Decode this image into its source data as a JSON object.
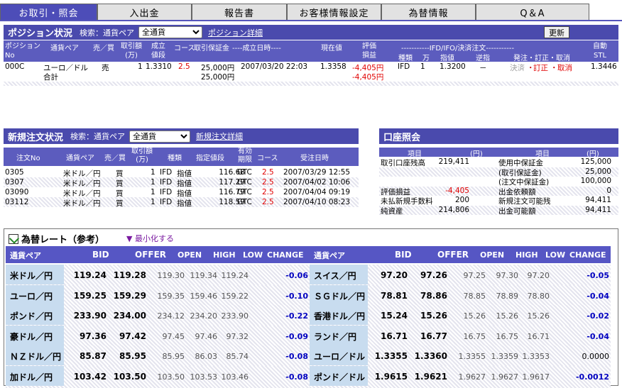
{
  "tabs": [
    {
      "label": "お取引・照会",
      "active": true
    },
    {
      "label": "入出金"
    },
    {
      "label": "報告書"
    },
    {
      "label": "お客様情報設定"
    },
    {
      "label": "為替情報"
    },
    {
      "label": "Q＆A"
    }
  ],
  "position": {
    "title": "ポジション状況",
    "search_label": "検索：通貨ペア",
    "select_value": "全通貨",
    "detail_link": "ポジション詳細",
    "refresh_label": "更新",
    "col_labels": {
      "no": "ポジション\nNo",
      "pair": "通貨ペア",
      "side": "売／買",
      "amount": "取引額\n(万)",
      "rate": "成立\n値段",
      "course": "コース",
      "margin": "取引保証金",
      "datetime": "----成立日時----",
      "current": "現在値",
      "pl": "評価\n損益",
      "ifo": "-----------IFD/IFO/決済注文-----------",
      "type": "種類",
      "man": "万",
      "limit": "指値",
      "stop": "逆指",
      "action": "発注・訂正・取消",
      "auto": "自動\nSTL"
    },
    "rows": [
      {
        "no": "000C",
        "pair": "ユーロ／ドル",
        "side": "売",
        "amount": "1",
        "rate": "1.3310",
        "course": "2.5",
        "margin": "25,000円",
        "datetime": "2007/03/20 22:03",
        "current": "1.3358",
        "pl": "-4,405円",
        "type": "IFD",
        "man": "1",
        "limit": "1.3200",
        "stop": "－",
        "act_settle": "決済",
        "act_edit": "訂正",
        "act_cancel": "取消",
        "auto": "1.3446"
      }
    ],
    "total_label": "合計",
    "total_margin": "25,000円",
    "total_pl": "-4,405円"
  },
  "orders": {
    "title": "新規注文状況",
    "search_label": "検索：通貨ペア",
    "select_value": "全通貨",
    "detail_link": "新規注文詳細",
    "col_labels": {
      "no": "注文No",
      "pair": "通貨ペア",
      "side": "売／買",
      "amount": "取引額\n(万)",
      "type": "種類",
      "spec": "指定値段",
      "expiry": "有効\n期限",
      "course": "コース",
      "datetime": "受注日時"
    },
    "rows": [
      {
        "no": "0305",
        "pair": "米ドル／円",
        "side": "買",
        "amount": "1",
        "type": "IFD",
        "kind": "指値",
        "price": "116.68",
        "expiry": "GTC",
        "course": "2.5",
        "datetime": "2007/03/29 12:55"
      },
      {
        "no": "0307",
        "pair": "米ドル／円",
        "side": "買",
        "amount": "1",
        "type": "IFD",
        "kind": "指値",
        "price": "117.29",
        "expiry": "GTC",
        "course": "2.5",
        "datetime": "2007/04/02 10:06"
      },
      {
        "no": "03090",
        "pair": "米ドル／円",
        "side": "買",
        "amount": "1",
        "type": "IFD",
        "kind": "指値",
        "price": "116.79",
        "expiry": "GTC",
        "course": "2.5",
        "datetime": "2007/04/04 09:19"
      },
      {
        "no": "03112",
        "pair": "米ドル／円",
        "side": "買",
        "amount": "1",
        "type": "IFD",
        "kind": "指値",
        "price": "118.59",
        "expiry": "GTC",
        "course": "2.5",
        "datetime": "2007/04/10 08:23"
      }
    ]
  },
  "account": {
    "title": "口座照会",
    "col_labels": {
      "item": "項目",
      "yen": "(円)",
      "item2": "項目",
      "yen2": "(円)"
    },
    "rows": [
      {
        "l": "取引口座残高",
        "lv": "219,411",
        "r": "使用中保証金",
        "rv": "125,000"
      },
      {
        "l": "",
        "lv": "",
        "r": "(取引保証金)",
        "rv": "25,000"
      },
      {
        "l": "",
        "lv": "",
        "r": "(注文中保証金)",
        "rv": "100,000"
      },
      {
        "l": "評価損益",
        "lv": "-4,405",
        "r": "出金依頼額",
        "rv": "0"
      },
      {
        "l": "未払新規手数料",
        "lv": "200",
        "r": "新規注文可能残",
        "rv": "94,411"
      },
      {
        "l": "純資産",
        "lv": "214,806",
        "r": "出金可能額",
        "rv": "94,411"
      }
    ]
  },
  "rates": {
    "title": "為替レート（参考）",
    "minimize": "▼ 最小化する",
    "headers": {
      "pair": "通貨ペア",
      "bid": "BID",
      "offer": "OFFER",
      "open": "OPEN",
      "high": "HIGH",
      "low": "LOW",
      "change": "CHANGE"
    },
    "left": [
      {
        "pair": "米ドル／円",
        "bid": "119.24",
        "offer": "119.28",
        "open": "119.30",
        "high": "119.34",
        "low": "119.24",
        "change": "-0.06"
      },
      {
        "pair": "ユーロ／円",
        "bid": "159.25",
        "offer": "159.29",
        "open": "159.35",
        "high": "159.46",
        "low": "159.22",
        "change": "-0.10"
      },
      {
        "pair": "ポンド／円",
        "bid": "233.90",
        "offer": "234.00",
        "open": "234.12",
        "high": "234.20",
        "low": "233.90",
        "change": "-0.22"
      },
      {
        "pair": "豪ドル／円",
        "bid": "97.36",
        "offer": "97.42",
        "open": "97.45",
        "high": "97.46",
        "low": "97.32",
        "change": "-0.09"
      },
      {
        "pair": "ＮＺドル／円",
        "bid": "85.87",
        "offer": "85.95",
        "open": "85.95",
        "high": "86.03",
        "low": "85.74",
        "change": "-0.08"
      },
      {
        "pair": "加ドル／円",
        "bid": "103.42",
        "offer": "103.50",
        "open": "103.50",
        "high": "103.53",
        "low": "103.46",
        "change": "-0.08"
      }
    ],
    "right": [
      {
        "pair": "スイス／円",
        "bid": "97.20",
        "offer": "97.26",
        "open": "97.25",
        "high": "97.30",
        "low": "97.20",
        "change": "-0.05"
      },
      {
        "pair": "ＳＧドル／円",
        "bid": "78.81",
        "offer": "78.86",
        "open": "78.85",
        "high": "78.89",
        "low": "78.80",
        "change": "-0.04"
      },
      {
        "pair": "香港ドル／円",
        "bid": "15.24",
        "offer": "15.26",
        "open": "15.26",
        "high": "15.26",
        "low": "15.26",
        "change": "-0.02"
      },
      {
        "pair": "ランド／円",
        "bid": "16.71",
        "offer": "16.77",
        "open": "16.75",
        "high": "16.75",
        "low": "16.71",
        "change": "-0.04"
      },
      {
        "pair": "ユーロ／ドル",
        "bid": "1.3355",
        "offer": "1.3360",
        "open": "1.3355",
        "high": "1.3359",
        "low": "1.3353",
        "change": "0.0000"
      },
      {
        "pair": "ポンド／ドル",
        "bid": "1.9615",
        "offer": "1.9621",
        "open": "1.9627",
        "high": "1.9627",
        "low": "1.9617",
        "change": "-0.0012"
      }
    ]
  }
}
